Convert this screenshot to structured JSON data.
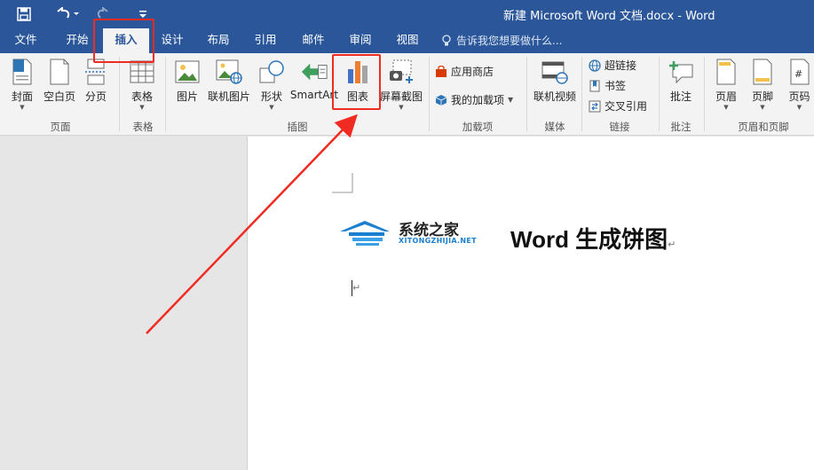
{
  "titlebar": {
    "window_title": "新建 Microsoft Word 文档.docx - Word",
    "save_icon": "save-icon",
    "undo_icon": "undo-icon",
    "redo_icon": "redo-icon",
    "customize_icon": "customize-qat-icon"
  },
  "tabs": [
    {
      "label": "文件"
    },
    {
      "label": "开始"
    },
    {
      "label": "插入"
    },
    {
      "label": "设计"
    },
    {
      "label": "布局"
    },
    {
      "label": "引用"
    },
    {
      "label": "邮件"
    },
    {
      "label": "审阅"
    },
    {
      "label": "视图"
    }
  ],
  "active_tab": "插入",
  "tell_me": {
    "placeholder": "告诉我您想要做什么..."
  },
  "ribbon": {
    "pages": {
      "cover": "封面",
      "blank": "空白页",
      "break": "分页",
      "group": "页面"
    },
    "tables": {
      "table": "表格",
      "group": "表格"
    },
    "illustrations": {
      "picture": "图片",
      "online_picture": "联机图片",
      "shapes": "形状",
      "smartart": "SmartArt",
      "chart": "图表",
      "screenshot": "屏幕截图",
      "group": "插图"
    },
    "addins": {
      "store": "应用商店",
      "my_addins": "我的加载项",
      "group": "加载项"
    },
    "media": {
      "online_video": "联机视频",
      "group": "媒体"
    },
    "links": {
      "hyperlink": "超链接",
      "bookmark": "书签",
      "cross_ref": "交叉引用",
      "group": "链接"
    },
    "comments": {
      "comment": "批注",
      "group": "批注"
    },
    "header_footer": {
      "header": "页眉",
      "footer": "页脚",
      "page_number": "页码",
      "group": "页眉和页脚"
    }
  },
  "document": {
    "logo_cn": "系统之家",
    "logo_en": "XITONGZHIJIA.NET",
    "heading": "Word 生成饼图",
    "paragraph_mark": "↵"
  },
  "annotation": {
    "color": "#ef2b22",
    "highlighted": [
      "插入",
      "图表"
    ]
  },
  "colors": {
    "accent": "#2b579a",
    "ribbon_bg": "#f3f3f3",
    "doc_bg": "#e6e6e6"
  }
}
